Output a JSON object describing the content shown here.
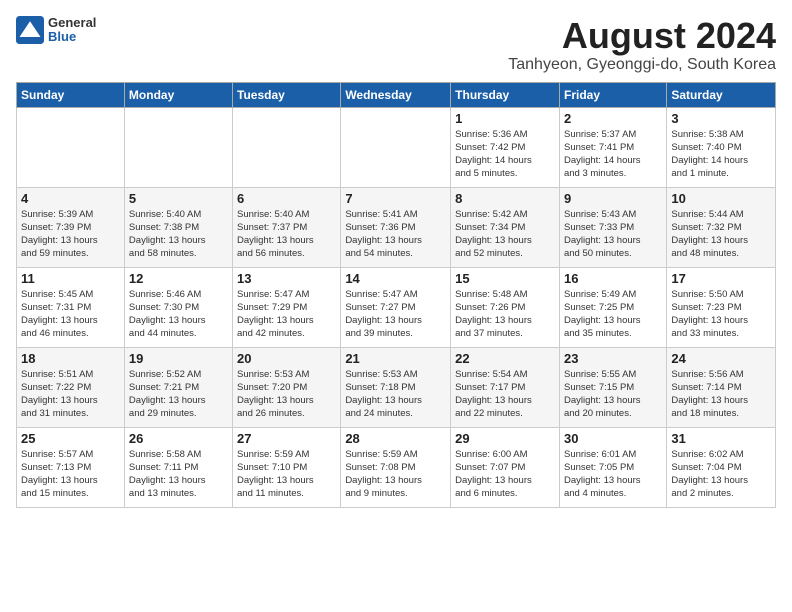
{
  "header": {
    "logo_general": "General",
    "logo_blue": "Blue",
    "month_year": "August 2024",
    "location": "Tanhyeon, Gyeonggi-do, South Korea"
  },
  "days_of_week": [
    "Sunday",
    "Monday",
    "Tuesday",
    "Wednesday",
    "Thursday",
    "Friday",
    "Saturday"
  ],
  "weeks": [
    [
      {
        "day": "",
        "info": ""
      },
      {
        "day": "",
        "info": ""
      },
      {
        "day": "",
        "info": ""
      },
      {
        "day": "",
        "info": ""
      },
      {
        "day": "1",
        "info": "Sunrise: 5:36 AM\nSunset: 7:42 PM\nDaylight: 14 hours\nand 5 minutes."
      },
      {
        "day": "2",
        "info": "Sunrise: 5:37 AM\nSunset: 7:41 PM\nDaylight: 14 hours\nand 3 minutes."
      },
      {
        "day": "3",
        "info": "Sunrise: 5:38 AM\nSunset: 7:40 PM\nDaylight: 14 hours\nand 1 minute."
      }
    ],
    [
      {
        "day": "4",
        "info": "Sunrise: 5:39 AM\nSunset: 7:39 PM\nDaylight: 13 hours\nand 59 minutes."
      },
      {
        "day": "5",
        "info": "Sunrise: 5:40 AM\nSunset: 7:38 PM\nDaylight: 13 hours\nand 58 minutes."
      },
      {
        "day": "6",
        "info": "Sunrise: 5:40 AM\nSunset: 7:37 PM\nDaylight: 13 hours\nand 56 minutes."
      },
      {
        "day": "7",
        "info": "Sunrise: 5:41 AM\nSunset: 7:36 PM\nDaylight: 13 hours\nand 54 minutes."
      },
      {
        "day": "8",
        "info": "Sunrise: 5:42 AM\nSunset: 7:34 PM\nDaylight: 13 hours\nand 52 minutes."
      },
      {
        "day": "9",
        "info": "Sunrise: 5:43 AM\nSunset: 7:33 PM\nDaylight: 13 hours\nand 50 minutes."
      },
      {
        "day": "10",
        "info": "Sunrise: 5:44 AM\nSunset: 7:32 PM\nDaylight: 13 hours\nand 48 minutes."
      }
    ],
    [
      {
        "day": "11",
        "info": "Sunrise: 5:45 AM\nSunset: 7:31 PM\nDaylight: 13 hours\nand 46 minutes."
      },
      {
        "day": "12",
        "info": "Sunrise: 5:46 AM\nSunset: 7:30 PM\nDaylight: 13 hours\nand 44 minutes."
      },
      {
        "day": "13",
        "info": "Sunrise: 5:47 AM\nSunset: 7:29 PM\nDaylight: 13 hours\nand 42 minutes."
      },
      {
        "day": "14",
        "info": "Sunrise: 5:47 AM\nSunset: 7:27 PM\nDaylight: 13 hours\nand 39 minutes."
      },
      {
        "day": "15",
        "info": "Sunrise: 5:48 AM\nSunset: 7:26 PM\nDaylight: 13 hours\nand 37 minutes."
      },
      {
        "day": "16",
        "info": "Sunrise: 5:49 AM\nSunset: 7:25 PM\nDaylight: 13 hours\nand 35 minutes."
      },
      {
        "day": "17",
        "info": "Sunrise: 5:50 AM\nSunset: 7:23 PM\nDaylight: 13 hours\nand 33 minutes."
      }
    ],
    [
      {
        "day": "18",
        "info": "Sunrise: 5:51 AM\nSunset: 7:22 PM\nDaylight: 13 hours\nand 31 minutes."
      },
      {
        "day": "19",
        "info": "Sunrise: 5:52 AM\nSunset: 7:21 PM\nDaylight: 13 hours\nand 29 minutes."
      },
      {
        "day": "20",
        "info": "Sunrise: 5:53 AM\nSunset: 7:20 PM\nDaylight: 13 hours\nand 26 minutes."
      },
      {
        "day": "21",
        "info": "Sunrise: 5:53 AM\nSunset: 7:18 PM\nDaylight: 13 hours\nand 24 minutes."
      },
      {
        "day": "22",
        "info": "Sunrise: 5:54 AM\nSunset: 7:17 PM\nDaylight: 13 hours\nand 22 minutes."
      },
      {
        "day": "23",
        "info": "Sunrise: 5:55 AM\nSunset: 7:15 PM\nDaylight: 13 hours\nand 20 minutes."
      },
      {
        "day": "24",
        "info": "Sunrise: 5:56 AM\nSunset: 7:14 PM\nDaylight: 13 hours\nand 18 minutes."
      }
    ],
    [
      {
        "day": "25",
        "info": "Sunrise: 5:57 AM\nSunset: 7:13 PM\nDaylight: 13 hours\nand 15 minutes."
      },
      {
        "day": "26",
        "info": "Sunrise: 5:58 AM\nSunset: 7:11 PM\nDaylight: 13 hours\nand 13 minutes."
      },
      {
        "day": "27",
        "info": "Sunrise: 5:59 AM\nSunset: 7:10 PM\nDaylight: 13 hours\nand 11 minutes."
      },
      {
        "day": "28",
        "info": "Sunrise: 5:59 AM\nSunset: 7:08 PM\nDaylight: 13 hours\nand 9 minutes."
      },
      {
        "day": "29",
        "info": "Sunrise: 6:00 AM\nSunset: 7:07 PM\nDaylight: 13 hours\nand 6 minutes."
      },
      {
        "day": "30",
        "info": "Sunrise: 6:01 AM\nSunset: 7:05 PM\nDaylight: 13 hours\nand 4 minutes."
      },
      {
        "day": "31",
        "info": "Sunrise: 6:02 AM\nSunset: 7:04 PM\nDaylight: 13 hours\nand 2 minutes."
      }
    ]
  ]
}
